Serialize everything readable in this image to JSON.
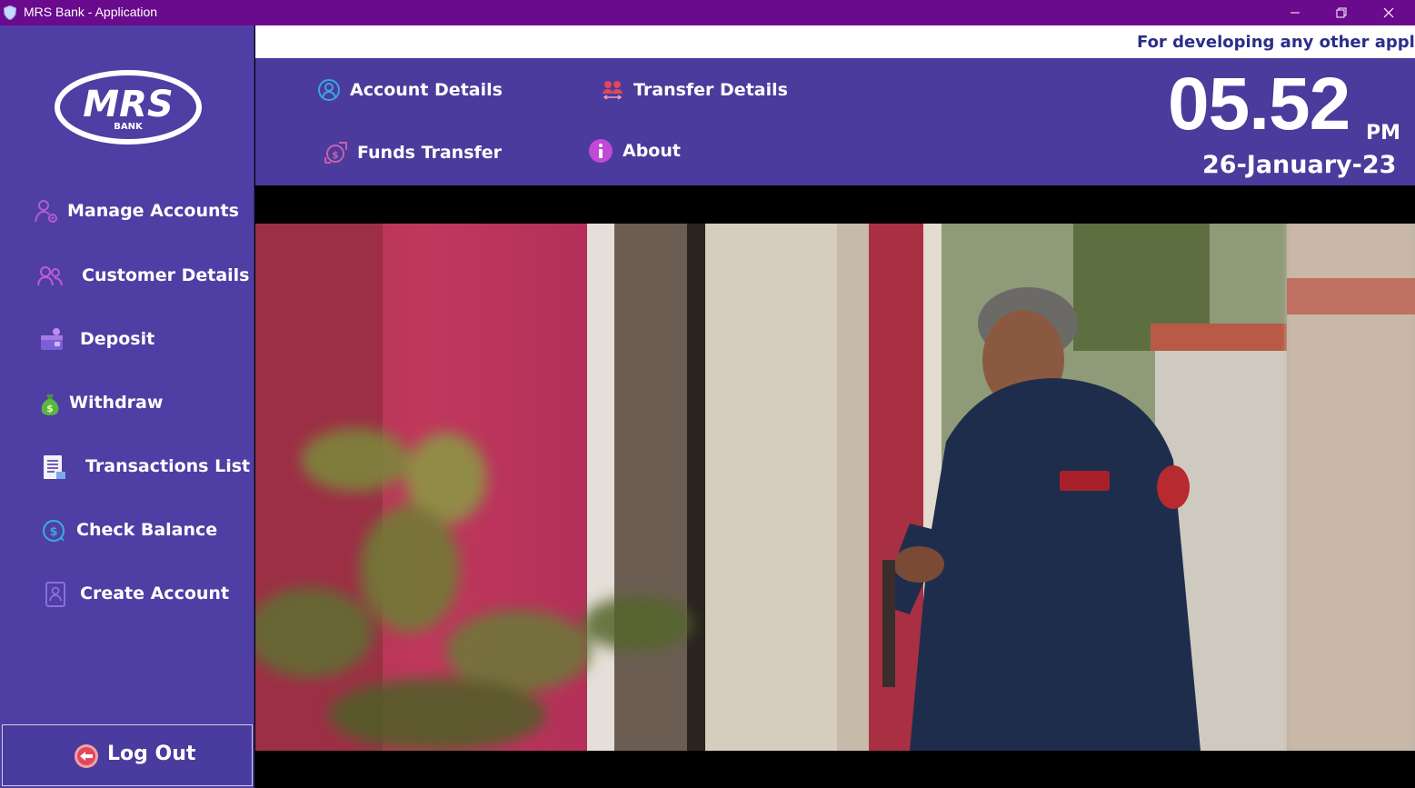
{
  "window": {
    "title": "MRS Bank - Application",
    "controls": [
      "minimize",
      "restore",
      "close"
    ]
  },
  "logo": {
    "brand": "MRS",
    "sub": "BANK"
  },
  "sidebar": {
    "items": [
      {
        "label": "Manage Accounts",
        "icon": "manage-accounts-icon"
      },
      {
        "label": "Customer Details",
        "icon": "customers-icon"
      },
      {
        "label": "Deposit",
        "icon": "deposit-icon"
      },
      {
        "label": "Withdraw",
        "icon": "money-bag-icon"
      },
      {
        "label": "Transactions List",
        "icon": "transactions-list-icon"
      },
      {
        "label": "Check  Balance",
        "icon": "balance-icon"
      },
      {
        "label": "Create Account",
        "icon": "create-account-icon"
      }
    ],
    "logout": {
      "label": "Log Out",
      "icon": "logout-icon"
    }
  },
  "ticker": {
    "text": "For developing any other applicatio"
  },
  "header": {
    "nav": [
      {
        "label": "Account Details",
        "icon": "account-details-icon"
      },
      {
        "label": "Transfer Details",
        "icon": "transfer-details-icon"
      },
      {
        "label": "Funds Transfer",
        "icon": "funds-transfer-icon"
      },
      {
        "label": "About",
        "icon": "info-icon"
      }
    ],
    "clock": {
      "time": "05.52",
      "ampm": "PM",
      "date": "26-January-23"
    }
  },
  "colors": {
    "titlebar": "#6a0a8c",
    "sidebar": "#4f3ea3",
    "header": "#4a3b9c",
    "ticker_text": "#2b2d8a"
  }
}
